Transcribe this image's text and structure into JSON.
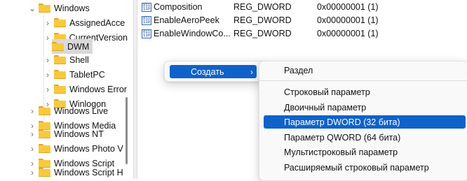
{
  "tree": {
    "items": [
      {
        "label": "Windows",
        "expanded": true
      },
      {
        "label": "AssignedAcce",
        "expanded": false
      },
      {
        "label": "CurrentVersion",
        "expanded": false
      },
      {
        "label": "DWM",
        "expanded": false,
        "selected": true
      },
      {
        "label": "Shell",
        "expanded": false
      },
      {
        "label": "TabletPC",
        "expanded": false
      },
      {
        "label": "Windows Error",
        "expanded": false
      },
      {
        "label": "Winlogon",
        "expanded": false
      },
      {
        "label": "Windows Live",
        "expanded": false
      },
      {
        "label": "Windows Media",
        "expanded": false
      },
      {
        "label": "Windows NT",
        "expanded": false
      },
      {
        "label": "Windows Photo V",
        "expanded": false
      },
      {
        "label": "Windows Script",
        "expanded": false
      },
      {
        "label": "Windows Script H",
        "expanded": false
      }
    ]
  },
  "values": {
    "rows": [
      {
        "name": "Composition",
        "type": "REG_DWORD",
        "data": "0x00000001 (1)"
      },
      {
        "name": "EnableAeroPeek",
        "type": "REG_DWORD",
        "data": "0x00000001 (1)"
      },
      {
        "name": "EnableWindowCo...",
        "type": "REG_DWORD",
        "data": "0x00000001 (1)"
      }
    ],
    "icon_text": "011\n110"
  },
  "context_menu": {
    "create_label": "Создать",
    "arrow": "›"
  },
  "submenu": {
    "items": [
      {
        "label": "Раздел"
      },
      {
        "label": "Строковый параметр"
      },
      {
        "label": "Двоичный параметр"
      },
      {
        "label": "Параметр DWORD (32 бита)",
        "highlighted": true
      },
      {
        "label": "Параметр QWORD (64 бита)"
      },
      {
        "label": "Мультистроковый параметр"
      },
      {
        "label": "Расширяемый строковый параметр"
      }
    ]
  },
  "colors": {
    "highlight": "#0f62c9",
    "folder": "#f8c93e",
    "selected_row": "#d9d9d9"
  }
}
